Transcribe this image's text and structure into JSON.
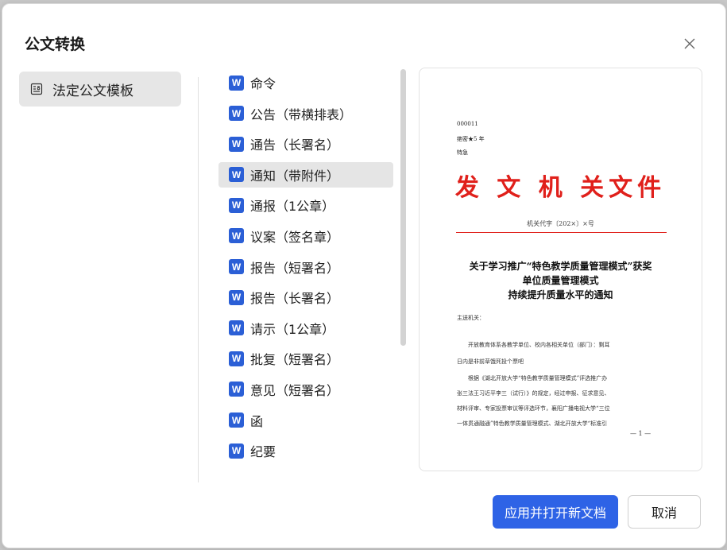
{
  "dialog": {
    "title": "公文转换",
    "close_icon": "close-icon"
  },
  "sidebar": {
    "items": [
      {
        "label": "法定公文模板",
        "icon": "template-icon",
        "selected": true
      }
    ]
  },
  "templates": {
    "items": [
      {
        "label": "命令",
        "selected": false
      },
      {
        "label": "公告（带横排表）",
        "selected": false
      },
      {
        "label": "通告（长署名）",
        "selected": false
      },
      {
        "label": "通知（带附件）",
        "selected": true
      },
      {
        "label": "通报（1公章）",
        "selected": false
      },
      {
        "label": "议案（签名章）",
        "selected": false
      },
      {
        "label": "报告（短署名）",
        "selected": false
      },
      {
        "label": "报告（长署名）",
        "selected": false
      },
      {
        "label": "请示（1公章）",
        "selected": false
      },
      {
        "label": "批复（短署名）",
        "selected": false
      },
      {
        "label": "意见（短署名）",
        "selected": false
      },
      {
        "label": "函",
        "selected": false
      },
      {
        "label": "纪要",
        "selected": false
      }
    ],
    "icon_letter": "W"
  },
  "preview": {
    "doc_number": "000011",
    "secret_level": "绝密★5 年",
    "urgency": "特急",
    "org_title": "发 文 机 关文件",
    "issue_code": "机关代字〔202×〕×号",
    "title_lines": [
      "关于学习推广“特色教学质量管理模式”获奖",
      "单位质量管理模式",
      "持续提升质量水平的通知"
    ],
    "recipient": "主送机关：",
    "body_lines": [
      "开放教育体系各教学单位、校内各相关单位（部门）：剩耳",
      "日内是非前草饿死投个票吧",
      "根据《湖北开放大学“特色教学质量管理模式”评选推广办",
      "张三法王习近平李三（试行）》的规定，经过申报、征求意见、",
      "材料评审、专家投票审议等评选环节，襄阳广播电视大学“三位",
      "一体贯通融通”特色教学质量管理模式、湖北开放大学“标准引"
    ],
    "page_number": "— 1 —",
    "colors": {
      "org_red": "#e0201b"
    }
  },
  "buttons": {
    "apply": "应用并打开新文档",
    "cancel": "取消"
  },
  "colors": {
    "primary": "#2e63e6",
    "word_blue": "#2b5fd6"
  }
}
